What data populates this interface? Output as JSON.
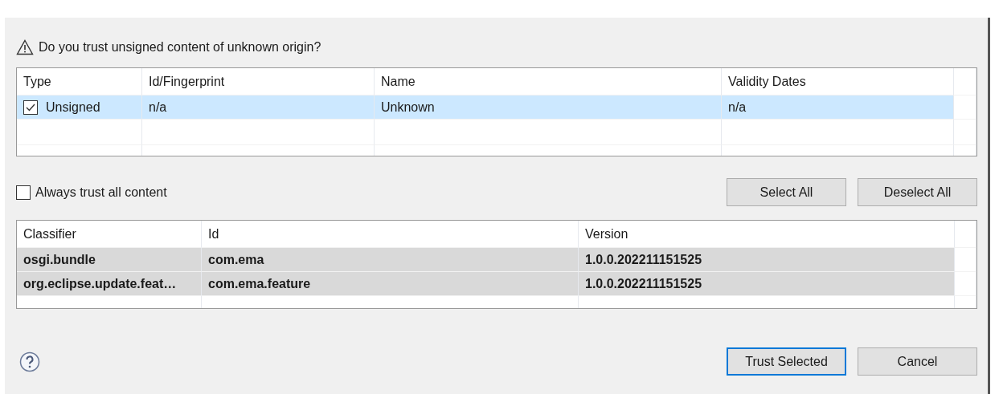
{
  "prompt": "Do you trust unsigned content of unknown origin?",
  "certificates": {
    "columns": [
      "Type",
      "Id/Fingerprint",
      "Name",
      "Validity Dates"
    ],
    "rows": [
      {
        "selected": true,
        "checked": true,
        "cells": [
          "Unsigned",
          "n/a",
          "Unknown",
          "n/a"
        ]
      }
    ]
  },
  "always_trust": {
    "label": "Always trust all content",
    "checked": false
  },
  "selection_buttons": [
    "Select All",
    "Deselect All"
  ],
  "artifacts": {
    "columns": [
      "Classifier",
      "Id",
      "Version"
    ],
    "rows": [
      {
        "selected": true,
        "cells": [
          "osgi.bundle",
          "com.ema",
          "1.0.0.202211151525"
        ]
      },
      {
        "selected": true,
        "cells": [
          "org.eclipse.update.feat…",
          "com.ema.feature",
          "1.0.0.202211151525"
        ]
      }
    ]
  },
  "footer_buttons": [
    {
      "label": "Trust Selected",
      "default": true
    },
    {
      "label": "Cancel",
      "default": false
    }
  ]
}
